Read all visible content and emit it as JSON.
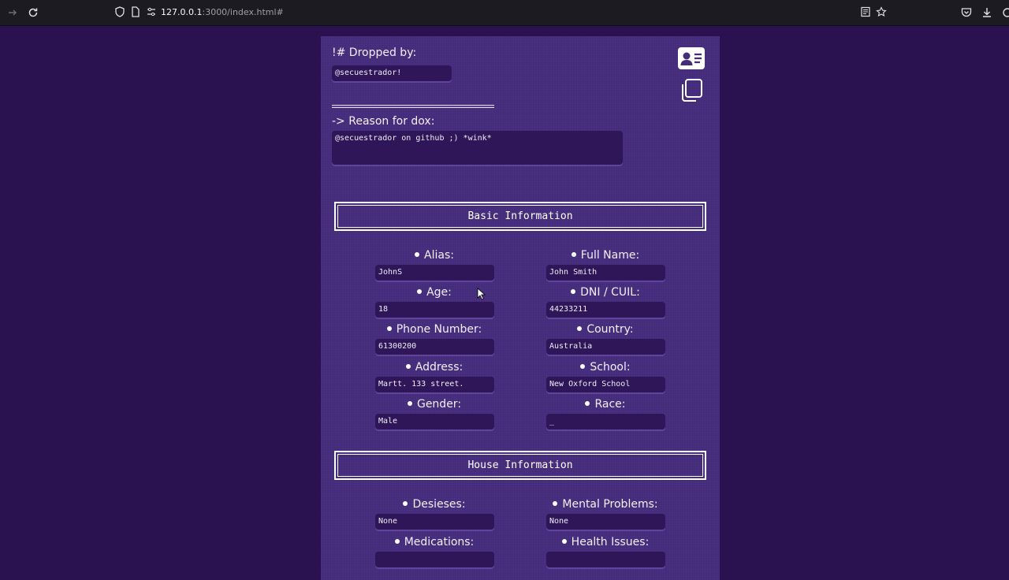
{
  "browser": {
    "url_host": "127.0.0.1",
    "url_rest": ":3000/index.html#"
  },
  "header": {
    "dropped_by_label": "!# Dropped by:",
    "dropped_by_value": "@secuestrador!",
    "reason_label": "-> Reason for dox:",
    "reason_value": "@secuestrador on github ;) *wink*"
  },
  "basic": {
    "title": "Basic Information",
    "fields": [
      {
        "label": "Alias:",
        "value": "JohnS"
      },
      {
        "label": "Full Name:",
        "value": "John Smith"
      },
      {
        "label": "Age:",
        "value": "18"
      },
      {
        "label": "DNI / CUIL:",
        "value": "44233211"
      },
      {
        "label": "Phone Number:",
        "value": "61300200"
      },
      {
        "label": "Country:",
        "value": "Australia"
      },
      {
        "label": "Address:",
        "value": "Martt. 133 street."
      },
      {
        "label": "School:",
        "value": "New Oxford School"
      },
      {
        "label": "Gender:",
        "value": "Male"
      },
      {
        "label": "Race:",
        "value": "_"
      }
    ]
  },
  "house": {
    "title": "House Information",
    "fields": [
      {
        "label": "Desieses:",
        "value": "None"
      },
      {
        "label": "Mental Problems:",
        "value": "None"
      },
      {
        "label": "Medications:",
        "value": ""
      },
      {
        "label": "Health Issues:",
        "value": ""
      }
    ]
  },
  "icons": {
    "back": "arrow-right-icon",
    "reload": "reload-icon",
    "shield": "shield-icon",
    "page": "page-icon",
    "settings": "site-settings-icon",
    "reader": "reader-view-icon",
    "bookmark": "star-icon",
    "pocket": "pocket-icon",
    "download": "download-icon",
    "card": "contact-card-icon",
    "copy": "copy-icon"
  }
}
